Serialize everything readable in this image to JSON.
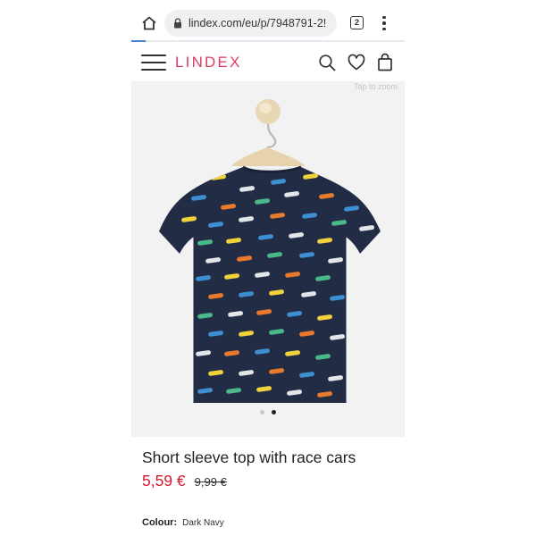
{
  "browser": {
    "url": "lindex.com/eu/p/7948791-2!",
    "tab_count": "2",
    "icons": {
      "home": "home-icon",
      "lock": "lock-icon",
      "menu": "more-vert-icon"
    }
  },
  "site": {
    "logo": "LINDEX",
    "brand_color": "#e03a63",
    "icons": [
      "hamburger-menu-icon",
      "search-icon",
      "heart-icon",
      "shopping-bag-icon"
    ]
  },
  "gallery": {
    "zoom_hint": "Tap to zoom",
    "image": "navy-tshirt-race-cars",
    "dots": [
      false,
      true
    ]
  },
  "product": {
    "title": "Short sleeve top with race cars",
    "price": "5,59 €",
    "old_price": "9,99 €",
    "price_color": "#d4172f",
    "colour_label": "Colour:",
    "colour_value": "Dark Navy"
  }
}
